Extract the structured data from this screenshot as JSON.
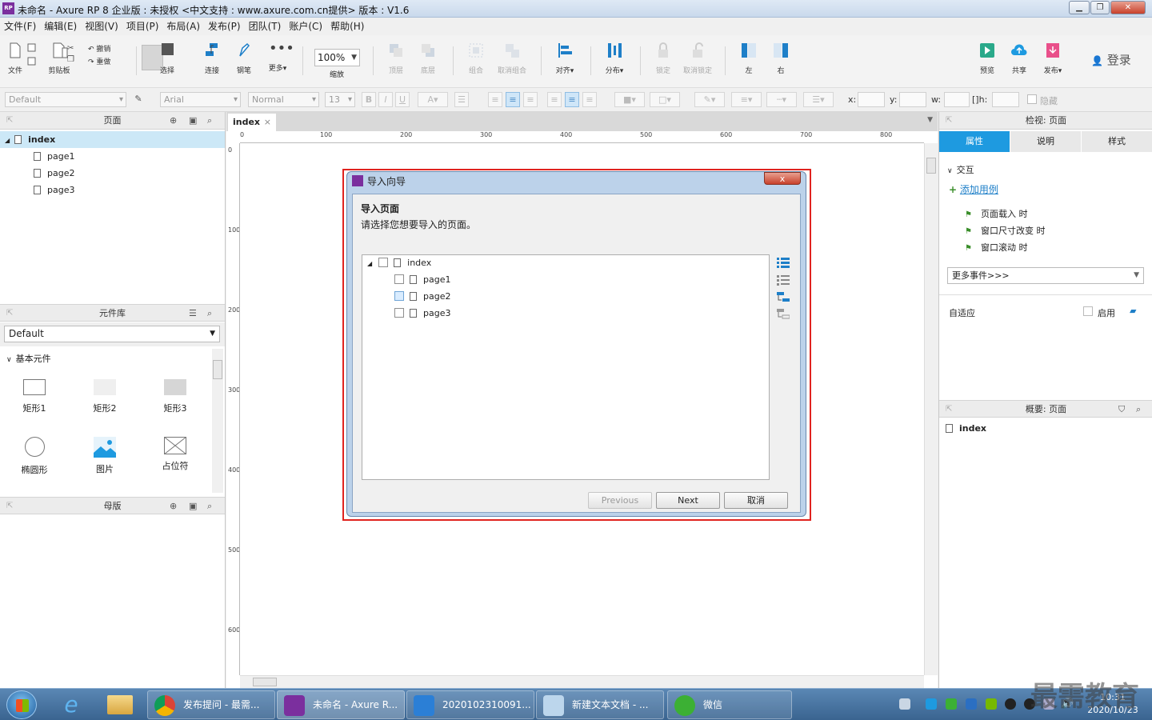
{
  "window": {
    "title": "未命名 - Axure RP 8 企业版 : 未授权     <中文支持 : www.axure.com.cn提供> 版本 : V1.6",
    "app_icon": "RP"
  },
  "menu": [
    "文件(F)",
    "编辑(E)",
    "视图(V)",
    "项目(P)",
    "布局(A)",
    "发布(P)",
    "团队(T)",
    "账户(C)",
    "帮助(H)"
  ],
  "toolbar": {
    "file": "文件",
    "clipboard": "剪贴板",
    "undo": "撤销",
    "redo": "重做",
    "select": "选择",
    "connect": "连接",
    "pen": "钢笔",
    "more": "更多▾",
    "zoom_value": "100%",
    "zoom_label": "缩放",
    "top": "顶层",
    "bottom": "底层",
    "group": "组合",
    "ungroup": "取消组合",
    "align": "对齐▾",
    "distribute": "分布▾",
    "lock": "锁定",
    "unlock": "取消锁定",
    "left": "左",
    "right": "右",
    "preview": "预览",
    "share": "共享",
    "publish": "发布▾",
    "login": "登录"
  },
  "format": {
    "style": "Default",
    "font": "Arial",
    "weight": "Normal",
    "size": "13",
    "x_label": "x:",
    "y_label": "y:",
    "w_label": "w:",
    "h_label": "h:",
    "hide": "隐藏"
  },
  "pages_panel": {
    "title": "页面",
    "items": [
      {
        "label": "index"
      },
      {
        "label": "page1"
      },
      {
        "label": "page2"
      },
      {
        "label": "page3"
      }
    ]
  },
  "library_panel": {
    "title": "元件库",
    "selected": "Default",
    "section": "基本元件",
    "widgets": [
      "矩形1",
      "矩形2",
      "矩形3",
      "椭圆形",
      "图片",
      "占位符"
    ]
  },
  "masters_panel": {
    "title": "母版"
  },
  "canvas": {
    "tab": "index",
    "h_ticks": [
      "0",
      "100",
      "200",
      "300",
      "400",
      "500",
      "600",
      "700",
      "800"
    ],
    "v_ticks": [
      "0",
      "100",
      "200",
      "300",
      "400",
      "500",
      "600"
    ]
  },
  "inspector": {
    "title": "检视: 页面",
    "tabs": [
      "属性",
      "说明",
      "样式"
    ],
    "interaction": "交互",
    "add_case": "添加用例",
    "events": [
      "页面载入 时",
      "窗口尺寸改变 时",
      "窗口滚动 时"
    ],
    "more_events": "更多事件>>>",
    "adaptive": "自适应",
    "enable": "启用"
  },
  "outline_panel": {
    "title": "概要: 页面",
    "item": "index"
  },
  "dialog": {
    "title": "导入向导",
    "heading": "导入页面",
    "subtitle": "请选择您想要导入的页面。",
    "tree": [
      {
        "label": "index"
      },
      {
        "label": "page1"
      },
      {
        "label": "page2"
      },
      {
        "label": "page3"
      }
    ],
    "prev": "Previous",
    "next": "Next",
    "cancel": "取消",
    "close": "x"
  },
  "taskbar": {
    "tasks": [
      "发布提问 - 最需...",
      "未命名 - Axure R...",
      "2020102310091...",
      "新建文本文档 - ...",
      "微信"
    ],
    "time": "10:31",
    "date": "2020/10/23",
    "watermark": "最需教育"
  }
}
